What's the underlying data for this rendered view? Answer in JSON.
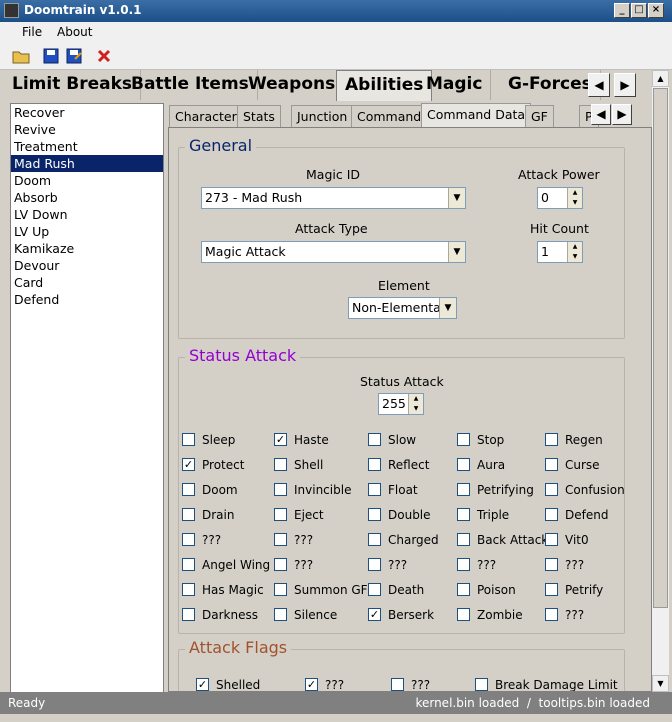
{
  "window": {
    "title": "Doomtrain v1.0.1"
  },
  "menu": [
    "File",
    "About"
  ],
  "main_tabs": [
    "Limit Breaks",
    "Battle Items",
    "Weapons",
    "Abilities",
    "Magic",
    "G-Forces"
  ],
  "list": [
    "Recover",
    "Revive",
    "Treatment",
    "Mad Rush",
    "Doom",
    "Absorb",
    "LV Down",
    "LV Up",
    "Kamikaze",
    "Devour",
    "Card",
    "Defend"
  ],
  "sub_tabs": [
    "Character",
    "Stats",
    "Junction",
    "Command",
    "Command Data",
    "GF",
    "P"
  ],
  "general": {
    "title": "General",
    "magic_id_label": "Magic ID",
    "magic_id": "273 - Mad Rush",
    "attack_power_label": "Attack Power",
    "attack_power": "0",
    "attack_type_label": "Attack Type",
    "attack_type": "Magic Attack",
    "hit_count_label": "Hit Count",
    "hit_count": "1",
    "element_label": "Element",
    "element": "Non-Elemental"
  },
  "status": {
    "title": "Status Attack",
    "label": "Status Attack",
    "value": "255",
    "items": [
      {
        "label": "Sleep",
        "checked": false
      },
      {
        "label": "Haste",
        "checked": true
      },
      {
        "label": "Slow",
        "checked": false
      },
      {
        "label": "Stop",
        "checked": false
      },
      {
        "label": "Regen",
        "checked": false
      },
      {
        "label": "Protect",
        "checked": true
      },
      {
        "label": "Shell",
        "checked": false
      },
      {
        "label": "Reflect",
        "checked": false
      },
      {
        "label": "Aura",
        "checked": false
      },
      {
        "label": "Curse",
        "checked": false
      },
      {
        "label": "Doom",
        "checked": false
      },
      {
        "label": "Invincible",
        "checked": false
      },
      {
        "label": "Float",
        "checked": false
      },
      {
        "label": "Petrifying",
        "checked": false
      },
      {
        "label": "Confusion",
        "checked": false
      },
      {
        "label": "Drain",
        "checked": false
      },
      {
        "label": "Eject",
        "checked": false
      },
      {
        "label": "Double",
        "checked": false
      },
      {
        "label": "Triple",
        "checked": false
      },
      {
        "label": "Defend",
        "checked": false
      },
      {
        "label": "???",
        "checked": false
      },
      {
        "label": "???",
        "checked": false
      },
      {
        "label": "Charged",
        "checked": false
      },
      {
        "label": "Back Attack",
        "checked": false
      },
      {
        "label": "Vit0",
        "checked": false
      },
      {
        "label": "Angel Wing",
        "checked": false
      },
      {
        "label": "???",
        "checked": false
      },
      {
        "label": "???",
        "checked": false
      },
      {
        "label": "???",
        "checked": false
      },
      {
        "label": "???",
        "checked": false
      },
      {
        "label": "Has Magic",
        "checked": false
      },
      {
        "label": "Summon GF",
        "checked": false
      },
      {
        "label": "Death",
        "checked": false
      },
      {
        "label": "Poison",
        "checked": false
      },
      {
        "label": "Petrify",
        "checked": false
      },
      {
        "label": "Darkness",
        "checked": false
      },
      {
        "label": "Silence",
        "checked": false
      },
      {
        "label": "Berserk",
        "checked": true
      },
      {
        "label": "Zombie",
        "checked": false
      },
      {
        "label": "???",
        "checked": false
      }
    ]
  },
  "flags": {
    "title": "Attack Flags",
    "items": [
      {
        "label": "Shelled",
        "checked": true
      },
      {
        "label": "???",
        "checked": true
      },
      {
        "label": "???",
        "checked": false
      },
      {
        "label": "Break Damage Limit",
        "checked": false
      }
    ]
  },
  "statusbar": {
    "left": "Ready",
    "right": "kernel.bin loaded  /  tooltips.bin loaded"
  },
  "colors": {
    "general": "#0a246a",
    "status": "#9400d3",
    "flags": "#a0522d",
    "selection": "#0a246a"
  }
}
